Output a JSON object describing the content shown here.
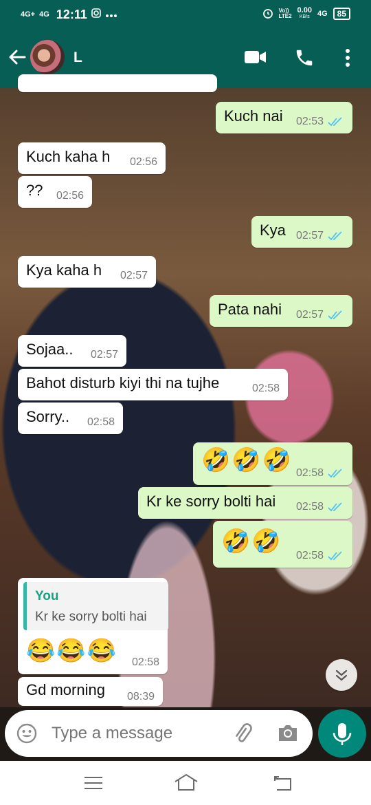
{
  "status_bar": {
    "network_1": "4G+",
    "network_2": "4G",
    "time": "12:11",
    "data_speed_value": "0.00",
    "data_speed_unit": "KB/s",
    "volte": "Vo))\nLTE2",
    "network_3": "4G",
    "battery": "85"
  },
  "header": {
    "contact_name": "L"
  },
  "messages": [
    {
      "dir": "out",
      "text": "Kuch nai",
      "time": "02:53",
      "ticks": "read"
    },
    {
      "dir": "in",
      "text": "Kuch kaha h",
      "time": "02:56"
    },
    {
      "dir": "in",
      "text": "??",
      "time": "02:56"
    },
    {
      "dir": "out",
      "text": "Kya",
      "time": "02:57",
      "ticks": "read"
    },
    {
      "dir": "in",
      "text": "Kya kaha h",
      "time": "02:57"
    },
    {
      "dir": "out",
      "text": "Pata nahi",
      "time": "02:57",
      "ticks": "read"
    },
    {
      "dir": "in",
      "text": "Sojaa..",
      "time": "02:57"
    },
    {
      "dir": "in",
      "text": "Bahot disturb kiyi thi na tujhe",
      "time": "02:58"
    },
    {
      "dir": "in",
      "text": "Sorry..",
      "time": "02:58"
    },
    {
      "dir": "out",
      "text": "🤣🤣🤣",
      "time": "02:58",
      "ticks": "read"
    },
    {
      "dir": "out",
      "text": "Kr ke sorry bolti hai",
      "time": "02:58",
      "ticks": "read"
    },
    {
      "dir": "out",
      "text": "🤣🤣",
      "time": "02:58",
      "ticks": "read"
    },
    {
      "dir": "in",
      "text": "😂😂😂",
      "time": "02:58",
      "quote": {
        "author": "You",
        "text": "Kr ke sorry bolti hai"
      }
    },
    {
      "dir": "in",
      "text": "Gd morning",
      "time": "08:39"
    }
  ],
  "input": {
    "placeholder": "Type a message"
  },
  "colors": {
    "header": "#075e54",
    "outgoing_bubble": "#dcf8c6",
    "incoming_bubble": "#ffffff",
    "read_ticks": "#4fc3f7",
    "mic_button": "#00897b"
  },
  "icons": [
    "back-arrow-icon",
    "video-call-icon",
    "voice-call-icon",
    "more-options-icon",
    "emoji-icon",
    "attach-icon",
    "camera-icon",
    "mic-icon",
    "scroll-down-icon",
    "menu-nav-icon",
    "home-nav-icon",
    "back-nav-icon"
  ]
}
